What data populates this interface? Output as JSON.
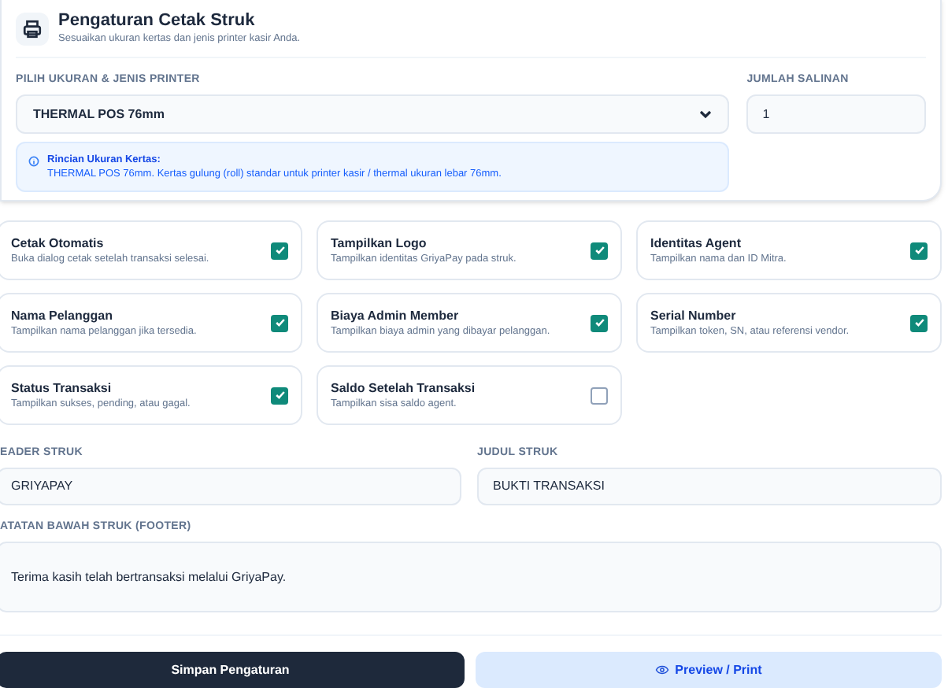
{
  "header": {
    "title": "Pengaturan Cetak Struk",
    "subtitle": "Sesuaikan ukuran kertas dan jenis printer kasir Anda."
  },
  "printer": {
    "label": "PILIH UKURAN & JENIS PRINTER",
    "value": "THERMAL POS 76mm"
  },
  "copies": {
    "label": "JUMLAH SALINAN",
    "value": "1"
  },
  "info": {
    "title": "Rincian Ukuran Kertas:",
    "text": "THERMAL POS 76mm. Kertas gulung (roll) standar untuk printer kasir / thermal ukuran lebar 76mm."
  },
  "options": [
    {
      "title": "Cetak Otomatis",
      "description": "Buka dialog cetak setelah transaksi selesai.",
      "checked": true
    },
    {
      "title": "Tampilkan Logo",
      "description": "Tampilkan identitas GriyaPay pada struk.",
      "checked": true
    },
    {
      "title": "Identitas Agent",
      "description": "Tampilkan nama dan ID Mitra.",
      "checked": true
    },
    {
      "title": "Nama Pelanggan",
      "description": "Tampilkan nama pelanggan jika tersedia.",
      "checked": true
    },
    {
      "title": "Biaya Admin Member",
      "description": "Tampilkan biaya admin yang dibayar pelanggan.",
      "checked": true
    },
    {
      "title": "Serial Number",
      "description": "Tampilkan token, SN, atau referensi vendor.",
      "checked": true
    },
    {
      "title": "Status Transaksi",
      "description": "Tampilkan sukses, pending, atau gagal.",
      "checked": true
    },
    {
      "title": "Saldo Setelah Transaksi",
      "description": "Tampilkan sisa saldo agent.",
      "checked": false
    }
  ],
  "header_field": {
    "label": "EADER STRUK",
    "value": "GRIYAPAY"
  },
  "title_field": {
    "label": "JUDUL STRUK",
    "value": "BUKTI TRANSAKSI"
  },
  "footer_field": {
    "label": "ATATAN BAWAH STRUK (FOOTER)",
    "value": "Terima kasih telah bertransaksi melalui GriyaPay."
  },
  "buttons": {
    "save": "Simpan Pengaturan",
    "preview": "Preview / Print"
  }
}
